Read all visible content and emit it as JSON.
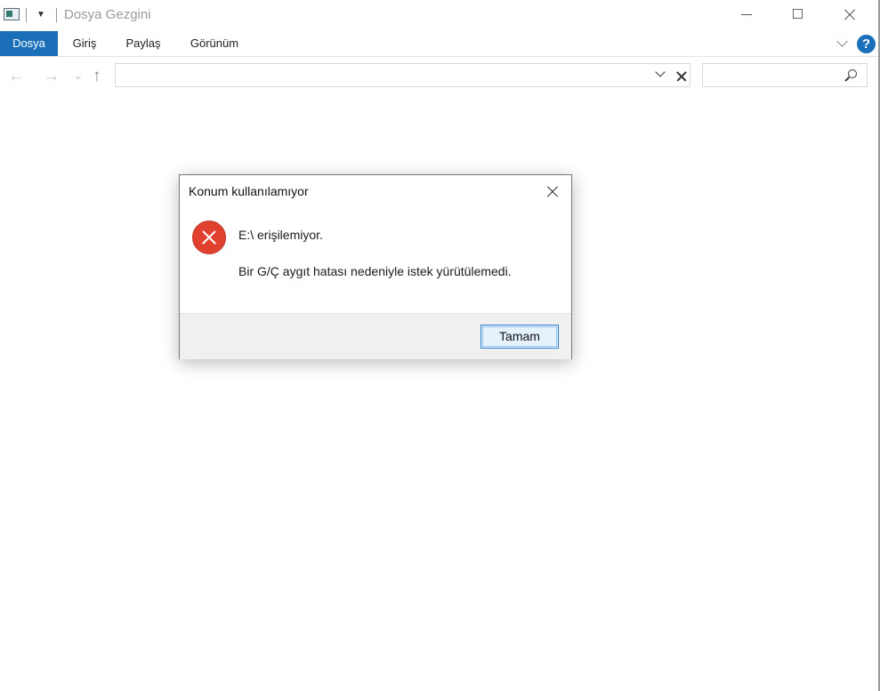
{
  "window": {
    "title": "Dosya Gezgini",
    "icon": "file-explorer-app-icon",
    "quick_access_icon": "customize-qat-icon"
  },
  "window_controls": {
    "minimize": "minimize-icon",
    "maximize": "maximize-icon",
    "close": "close-icon"
  },
  "ribbon": {
    "tabs": [
      {
        "label": "Dosya",
        "active": true
      },
      {
        "label": "Giriş"
      },
      {
        "label": "Paylaş"
      },
      {
        "label": "Görünüm"
      }
    ],
    "help_label": "?",
    "accent_color": "#1a6fb8"
  },
  "navigation": {
    "back_glyph": "←",
    "forward_glyph": "→",
    "recent_glyph": "⌄",
    "up_glyph": "↑",
    "address_value": "",
    "search_placeholder": ""
  },
  "dialog": {
    "title": "Konum kullanılamıyor",
    "icon": "error-icon",
    "icon_color": "#e0412f",
    "message_primary": "E:\\ erişilemiyor.",
    "message_secondary": "Bir G/Ç aygıt hatası nedeniyle istek yürütülemedi.",
    "ok_label": "Tamam"
  }
}
